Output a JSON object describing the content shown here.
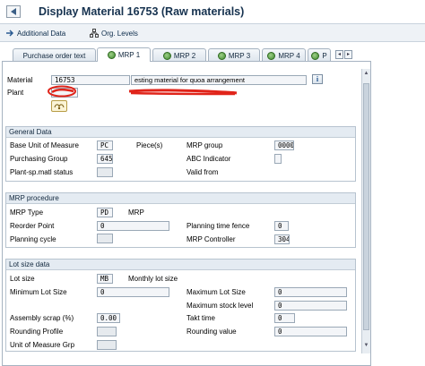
{
  "window": {
    "title": "Display Material 16753 (Raw materials)"
  },
  "toolbar": {
    "additional_data_label": "Additional Data",
    "org_levels_label": "Org. Levels"
  },
  "tabs": [
    {
      "label": "Purchase order text",
      "active": false,
      "icon": ""
    },
    {
      "label": "MRP 1",
      "active": true,
      "icon": "green-ball-icon"
    },
    {
      "label": "MRP 2",
      "active": false,
      "icon": "green-ball-icon"
    },
    {
      "label": "MRP 3",
      "active": false,
      "icon": "green-ball-icon"
    },
    {
      "label": "MRP 4",
      "active": false,
      "icon": "green-ball-icon"
    },
    {
      "label": "P",
      "active": false,
      "icon": "green-ball-icon"
    }
  ],
  "header": {
    "material_label": "Material",
    "material_value": "16753",
    "description_value": "esting material for quoa arrangement",
    "plant_label": "Plant",
    "plant_value": "",
    "info_label": "i"
  },
  "general_data": {
    "title": "General Data",
    "base_uom_label": "Base Unit of Measure",
    "base_uom_value": "PC",
    "base_uom_text": "Piece(s)",
    "mrp_group_label": "MRP group",
    "mrp_group_value": "0000",
    "purchasing_group_label": "Purchasing Group",
    "purchasing_group_value": "645",
    "abc_indicator_label": "ABC Indicator",
    "abc_indicator_value": "",
    "plant_sp_status_label": "Plant-sp.matl status",
    "plant_sp_status_value": "",
    "valid_from_label": "Valid from",
    "valid_from_value": ""
  },
  "mrp_procedure": {
    "title": "MRP procedure",
    "mrp_type_label": "MRP Type",
    "mrp_type_value": "PD",
    "mrp_type_text": "MRP",
    "reorder_point_label": "Reorder Point",
    "reorder_point_value": "0",
    "planning_time_fence_label": "Planning time fence",
    "planning_time_fence_value": "0",
    "planning_cycle_label": "Planning cycle",
    "planning_cycle_value": "",
    "mrp_controller_label": "MRP Controller",
    "mrp_controller_value": "304"
  },
  "lot_size_data": {
    "title": "Lot size data",
    "lot_size_label": "Lot size",
    "lot_size_value": "MB",
    "lot_size_text": "Monthly lot size",
    "min_lot_size_label": "Minimum Lot Size",
    "min_lot_size_value": "0",
    "max_lot_size_label": "Maximum Lot Size",
    "max_lot_size_value": "0",
    "max_stock_level_label": "Maximum stock level",
    "max_stock_level_value": "0",
    "assembly_scrap_label": "Assembly scrap (%)",
    "assembly_scrap_value": "0.00",
    "takt_time_label": "Takt time",
    "takt_time_value": "0",
    "rounding_profile_label": "Rounding Profile",
    "rounding_profile_value": "",
    "rounding_value_label": "Rounding value",
    "rounding_value_value": "0",
    "uom_group_label": "Unit of Measure Grp",
    "uom_group_value": ""
  },
  "colors": {
    "title": "#16324f",
    "group_header": "#e4ebf2",
    "scribble": "#e0241a"
  }
}
